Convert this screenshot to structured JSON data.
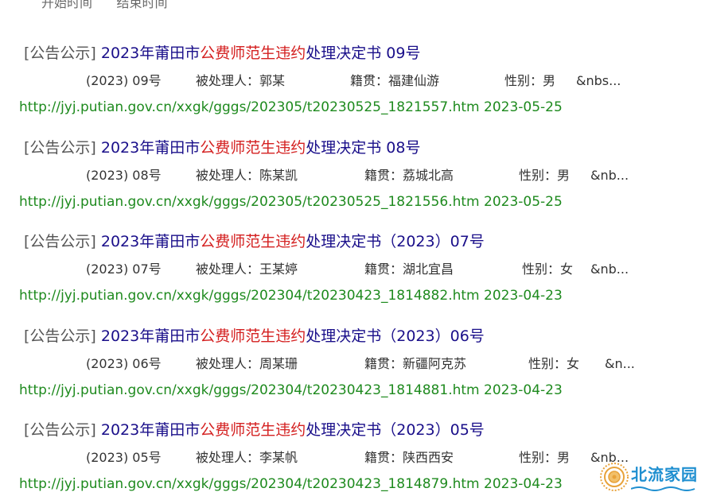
{
  "top_cut_text": "开始时间      结束时间",
  "results": [
    {
      "tag": "[公告公示]",
      "title_pre": "2023年莆田市",
      "title_hl": "公费师范生违约",
      "title_post": "处理决定书 09号",
      "num": "(2023) 09号",
      "person": "被处理人：郭某",
      "origin": "籍贯：福建仙游",
      "gender": "性别：男",
      "tail": "&nbs...",
      "url": "http://jyj.putian.gov.cn/xxgk/gggs/202305/t20230525_1821557.htm",
      "date": "2023-05-25"
    },
    {
      "tag": "[公告公示]",
      "title_pre": "2023年莆田市",
      "title_hl": "公费师范生违约",
      "title_post": "处理决定书 08号",
      "num": "(2023) 08号",
      "person": "被处理人：陈某凯",
      "origin": "籍贯：荔城北高",
      "gender": "性别：男",
      "tail": "&nb...",
      "url": "http://jyj.putian.gov.cn/xxgk/gggs/202305/t20230525_1821556.htm",
      "date": "2023-05-25"
    },
    {
      "tag": "[公告公示]",
      "title_pre": "2023年莆田市",
      "title_hl": "公费师范生违约",
      "title_post": "处理决定书（2023）07号",
      "num": "(2023) 07号",
      "person": "被处理人：王某婷",
      "origin": "籍贯：湖北宜昌",
      "gender": "性别：女",
      "tail": "&nb...",
      "url": "http://jyj.putian.gov.cn/xxgk/gggs/202304/t20230423_1814882.htm",
      "date": "2023-04-23"
    },
    {
      "tag": "[公告公示]",
      "title_pre": "2023年莆田市",
      "title_hl": "公费师范生违约",
      "title_post": "处理决定书（2023）06号",
      "num": "(2023) 06号",
      "person": "被处理人：周某珊",
      "origin": "籍贯：新疆阿克苏",
      "gender": "性别：女",
      "tail": "&n...",
      "url": "http://jyj.putian.gov.cn/xxgk/gggs/202304/t20230423_1814881.htm",
      "date": "2023-04-23"
    },
    {
      "tag": "[公告公示]",
      "title_pre": "2023年莆田市",
      "title_hl": "公费师范生违约",
      "title_post": "处理决定书（2023）05号",
      "num": "(2023) 05号",
      "person": "被处理人：李某帆",
      "origin": "籍贯：陕西西安",
      "gender": "性别：男",
      "tail": "&nb...",
      "url": "http://jyj.putian.gov.cn/xxgk/gggs/202304/t20230423_1814879.htm",
      "date": "2023-04-23"
    }
  ],
  "watermark": {
    "text": "北流家园",
    "icon": "sun-emblem-icon",
    "color": "#1f8fd0",
    "emblem_color": "#e8a23a"
  }
}
